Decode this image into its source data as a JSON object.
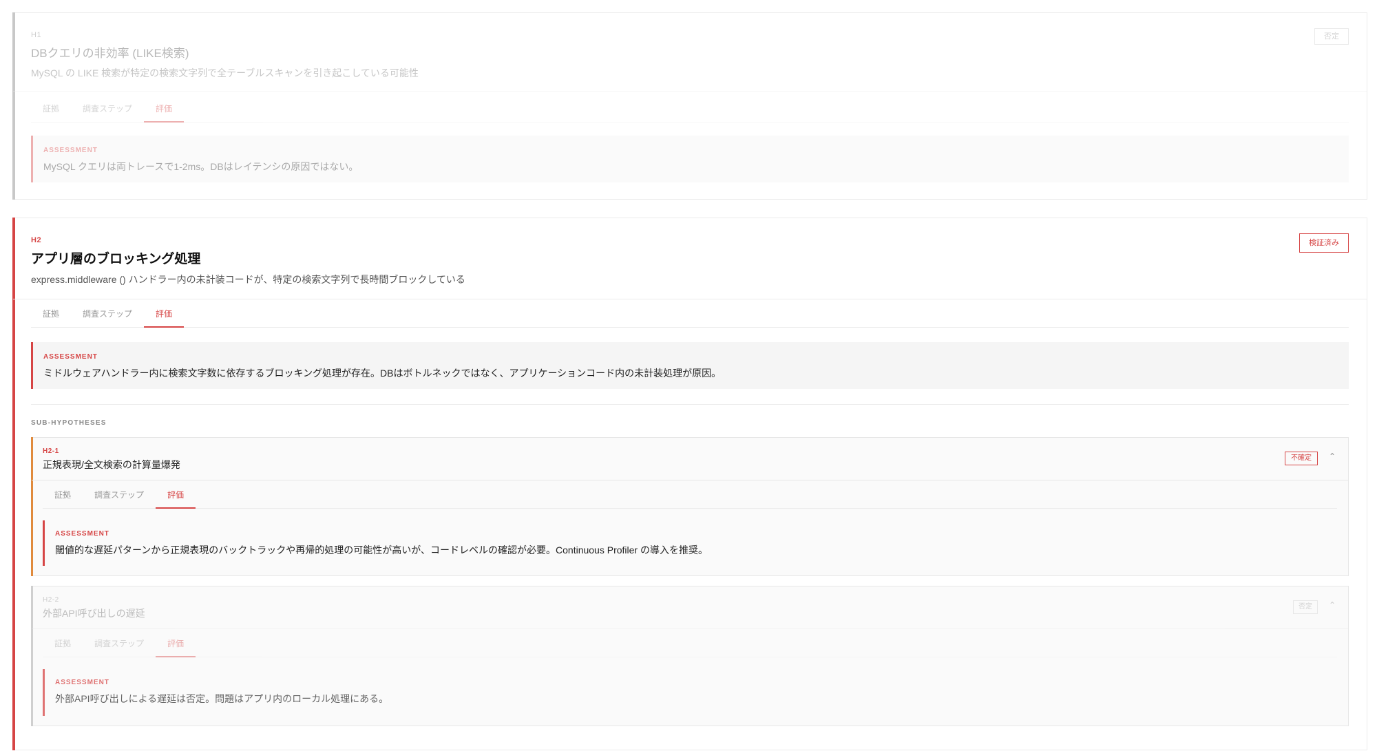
{
  "colors": {
    "accent": "#d64545",
    "muted": "#bdbdbd",
    "card_bg": "#ffffff"
  },
  "tab_labels": [
    "証拠",
    "調査ステップ",
    "評価"
  ],
  "assessment_label": "ASSESSMENT",
  "h1": {
    "id": "H1",
    "title": "DBクエリの非効率 (LIKE検索)",
    "description": "MySQL の LIKE 検索が特定の検索文字列で全テーブルスキャンを引き起こしている可能性",
    "status": "否定",
    "active_tab": "評価",
    "assessment": "MySQL クエリは両トレースで1-2ms。DBはレイテンシの原因ではない。"
  },
  "h2": {
    "id": "H2",
    "title": "アプリ層のブロッキング処理",
    "description": "express.middleware () ハンドラー内の未計装コードが、特定の検索文字列で長時間ブロックしている",
    "status": "検証済み",
    "active_tab": "評価",
    "assessment": "ミドルウェアハンドラー内に検索文字数に依存するブロッキング処理が存在。DBはボトルネックではなく、アプリケーションコード内の未計装処理が原因。",
    "sub_label": "SUB-HYPOTHESES",
    "subs": [
      {
        "id": "H2-1",
        "title": "正規表現/全文検索の計算量爆発",
        "status": "不確定",
        "active_tab": "評価",
        "assessment": "閾値的な遅延パターンから正規表現のバックトラックや再帰的処理の可能性が高いが、コードレベルの確認が必要。Continuous Profiler の導入を推奨。"
      },
      {
        "id": "H2-2",
        "title": "外部API呼び出しの遅延",
        "status": "否定",
        "active_tab": "評価",
        "assessment": "外部API呼び出しによる遅延は否定。問題はアプリ内のローカル処理にある。"
      }
    ]
  }
}
